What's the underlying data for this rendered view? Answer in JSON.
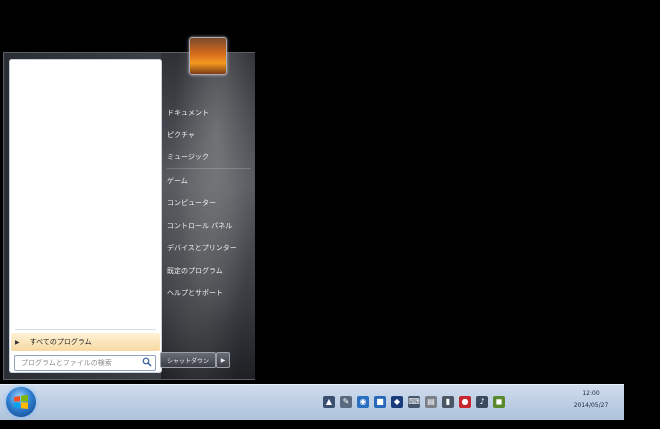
{
  "start_menu": {
    "all_programs_label": "すべてのプログラム",
    "search_placeholder": "プログラムとファイルの検索",
    "right_items": [
      {
        "label": "ドキュメント"
      },
      {
        "label": "ピクチャ"
      },
      {
        "label": "ミュージック"
      },
      {
        "label": "ゲーム"
      },
      {
        "label": "コンピューター"
      },
      {
        "label": "コントロール パネル"
      },
      {
        "label": "デバイスとプリンター"
      },
      {
        "label": "既定のプログラム"
      },
      {
        "label": "ヘルプとサポート"
      }
    ],
    "shutdown_label": "シャットダウン",
    "shutdown_arrow": "▶"
  },
  "taskbar": {
    "tray_icons": [
      {
        "name": "show-hidden-icons-icon",
        "glyph": "▲",
        "color": "#3a4f70"
      },
      {
        "name": "pen-icon",
        "glyph": "✎",
        "color": "#5a6a80"
      },
      {
        "name": "network-icon",
        "glyph": "◉",
        "color": "#2a6fc0"
      },
      {
        "name": "display-icon",
        "glyph": "■",
        "color": "#2868b8"
      },
      {
        "name": "shield-icon",
        "glyph": "◆",
        "color": "#1a3c7a"
      },
      {
        "name": "keyboard-icon",
        "glyph": "⌨",
        "color": "#44546a"
      },
      {
        "name": "document-icon",
        "glyph": "▤",
        "color": "#7a7f88"
      },
      {
        "name": "battery-icon",
        "glyph": "▮",
        "color": "#4a5566"
      },
      {
        "name": "antivirus-icon",
        "glyph": "●",
        "color": "#c8262e"
      },
      {
        "name": "volume-icon",
        "glyph": "♪",
        "color": "#3a4a5e"
      },
      {
        "name": "app-icon",
        "glyph": "◼",
        "color": "#5b8a2e"
      }
    ],
    "clock_time": "12:00",
    "clock_date": "2014/05/27"
  }
}
